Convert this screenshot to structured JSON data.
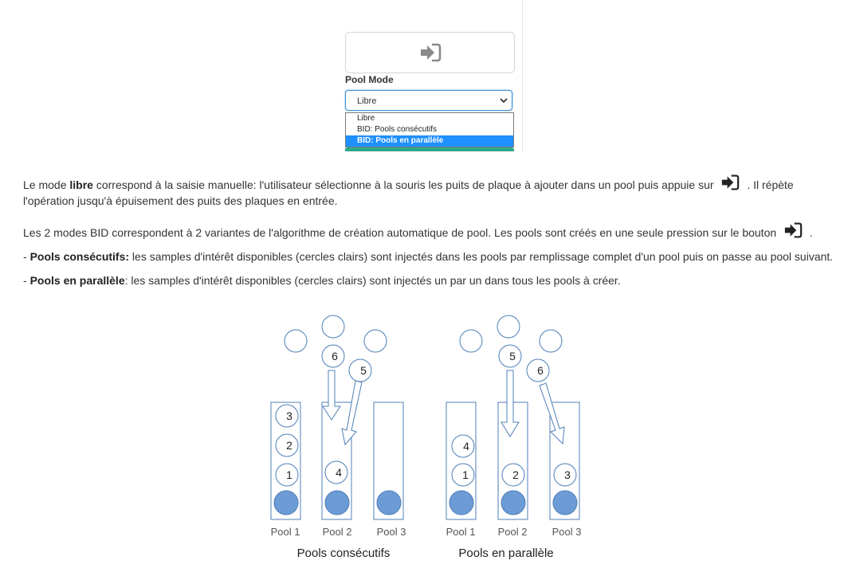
{
  "panel": {
    "pool_mode_label": "Pool Mode",
    "select_value": "Libre",
    "options": [
      "Libre",
      "BID: Pools consécutifs",
      "BID: Pools en parallèle"
    ],
    "selected_option_index": 2,
    "enter_icon": "sign-in-icon",
    "accent_color": "#1e90ff"
  },
  "text": {
    "p1": {
      "a": "Le mode ",
      "b": "libre",
      "c": " correspond à la saisie manuelle: l'utilisateur sélectionne à la souris les puits de plaque à ajouter dans un pool puis appuie sur ",
      "d": " . Il répète l'opération jusqu'à épuisement des puits des plaques en entrée."
    },
    "p2": {
      "a": "Les 2 modes BID correspondent à 2 variantes de l'algorithme de création automatique de pool. Les pools sont créés en une seule pression sur le bouton ",
      "b": " ."
    },
    "p3": {
      "a": "- ",
      "b": "Pools consécutifs:",
      "c": " les samples d'intérêt disponibles (cercles clairs) sont injectés dans les pools par remplissage complet d'un pool puis on passe au pool suivant."
    },
    "p4": {
      "a": "- ",
      "b": "Pools en parallèle",
      "c": ": les samples d'intérêt disponibles (cercles clairs) sont injectés un par un dans tous les pools à créer."
    }
  },
  "diagram": {
    "left": {
      "caption": "Pools consécutifs",
      "pool_labels": [
        "Pool 1",
        "Pool 2",
        "Pool 3"
      ],
      "pool1_samples": [
        "3",
        "2",
        "1"
      ],
      "pool2_samples": [
        "4"
      ],
      "incoming": [
        "6",
        "5"
      ]
    },
    "right": {
      "caption": "Pools en parallèle",
      "pool_labels": [
        "Pool 1",
        "Pool 2",
        "Pool 3"
      ],
      "pool1_samples": [
        "4",
        "1"
      ],
      "pool2_samples": [
        "2"
      ],
      "pool3_samples": [
        "3"
      ],
      "incoming": [
        "5",
        "6"
      ]
    },
    "filled_color": "#6d9bd6",
    "outline_color": "#4f7fb8"
  }
}
